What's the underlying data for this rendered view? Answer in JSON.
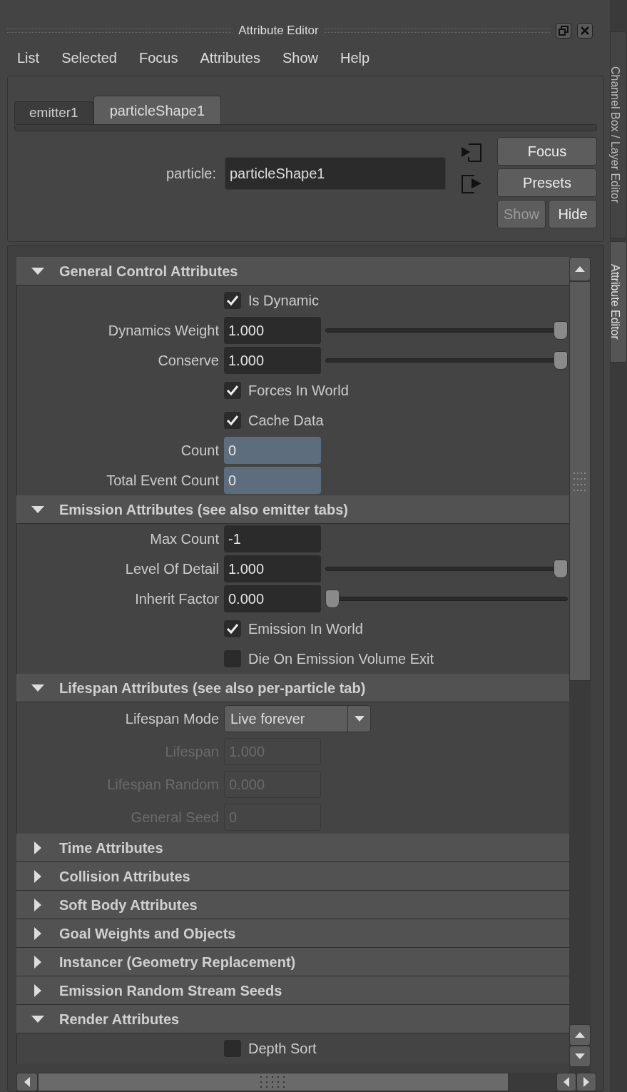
{
  "window": {
    "title": "Attribute Editor"
  },
  "menu": [
    "List",
    "Selected",
    "Focus",
    "Attributes",
    "Show",
    "Help"
  ],
  "tabs": [
    {
      "label": "emitter1",
      "selected": false
    },
    {
      "label": "particleShape1",
      "selected": true
    }
  ],
  "node": {
    "label": "particle:",
    "value": "particleShape1"
  },
  "side_buttons": [
    {
      "label": "Focus",
      "disabled": false
    },
    {
      "label": "Presets",
      "disabled": false
    },
    {
      "label": "Show",
      "disabled": true
    },
    {
      "label": "Hide",
      "disabled": false
    }
  ],
  "sections": [
    {
      "title": "General Control Attributes",
      "expanded": true,
      "rows": [
        {
          "kind": "checkbox",
          "label": "Is Dynamic",
          "checked": true
        },
        {
          "kind": "slider",
          "label": "Dynamics Weight",
          "value": "1.000",
          "level": 1
        },
        {
          "kind": "slider",
          "label": "Conserve",
          "value": "1.000",
          "level": 1
        },
        {
          "kind": "checkbox",
          "label": "Forces In World",
          "checked": true
        },
        {
          "kind": "checkbox",
          "label": "Cache Data",
          "checked": true
        },
        {
          "kind": "field",
          "label": "Count",
          "value": "0",
          "locked": true,
          "disabled": false
        },
        {
          "kind": "field",
          "label": "Total Event Count",
          "value": "0",
          "locked": true,
          "disabled": false
        }
      ]
    },
    {
      "title": "Emission Attributes (see also emitter tabs)",
      "expanded": true,
      "rows": [
        {
          "kind": "field",
          "label": "Max Count",
          "value": "-1",
          "locked": false,
          "disabled": false
        },
        {
          "kind": "slider",
          "label": "Level Of Detail",
          "value": "1.000",
          "level": 1
        },
        {
          "kind": "slider",
          "label": "Inherit Factor",
          "value": "0.000",
          "level": 0
        },
        {
          "kind": "checkbox",
          "label": "Emission In World",
          "checked": true
        },
        {
          "kind": "checkbox",
          "label": "Die On Emission Volume Exit",
          "checked": false
        }
      ]
    },
    {
      "title": "Lifespan Attributes (see also per-particle tab)",
      "expanded": true,
      "rows": [
        {
          "kind": "dropdown",
          "label": "Lifespan Mode",
          "value": "Live forever"
        },
        {
          "kind": "field",
          "label": "Lifespan",
          "value": "1.000",
          "locked": false,
          "disabled": true
        },
        {
          "kind": "field",
          "label": "Lifespan Random",
          "value": "0.000",
          "locked": false,
          "disabled": true
        },
        {
          "kind": "field",
          "label": "General Seed",
          "value": "0",
          "locked": false,
          "disabled": true
        }
      ]
    },
    {
      "title": "Time Attributes",
      "expanded": false
    },
    {
      "title": "Collision Attributes",
      "expanded": false
    },
    {
      "title": "Soft Body Attributes",
      "expanded": false
    },
    {
      "title": "Goal Weights and Objects",
      "expanded": false
    },
    {
      "title": "Instancer (Geometry Replacement)",
      "expanded": false
    },
    {
      "title": "Emission Random Stream Seeds",
      "expanded": false
    },
    {
      "title": "Render Attributes",
      "expanded": true,
      "rows": [
        {
          "kind": "checkbox",
          "label": "Depth Sort",
          "checked": false
        }
      ]
    }
  ],
  "side_tabs": [
    {
      "label": "Channel Box / Layer Editor",
      "selected": false
    },
    {
      "label": "Attribute Editor",
      "selected": true
    }
  ]
}
